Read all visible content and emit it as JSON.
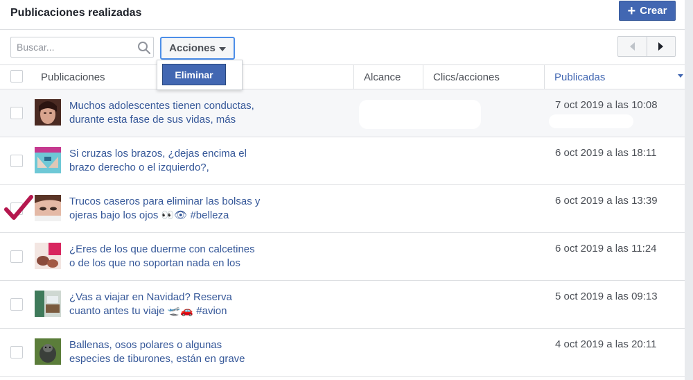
{
  "header": {
    "title": "Publicaciones realizadas",
    "create_label": "Crear"
  },
  "toolbar": {
    "search_placeholder": "Buscar...",
    "actions_label": "Acciones",
    "dropdown_item": "Eliminar"
  },
  "table": {
    "columns": [
      "Publicaciones",
      "Alcance",
      "Clics/acciones",
      "Publicadas"
    ],
    "rows": [
      {
        "line1": "Muchos adolescentes tienen conductas,",
        "line2": "durante esta fase de sus vidas, más",
        "date": "7 oct 2019 a las 10:08"
      },
      {
        "line1": "Si cruzas los brazos, ¿dejas encima el",
        "line2": "brazo derecho o el izquierdo?,",
        "date": "6 oct 2019 a las 18:11"
      },
      {
        "line1": "Trucos caseros para eliminar las bolsas y",
        "line2": "ojeras bajo los ojos 👀👁 #belleza",
        "date": "6 oct 2019 a las 13:39"
      },
      {
        "line1": "¿Eres de los que duerme con calcetines",
        "line2": "o de los que no soportan nada en los",
        "date": "6 oct 2019 a las 11:24"
      },
      {
        "line1": "¿Vas a viajar en Navidad? Reserva",
        "line2": "cuanto antes tu viaje 🛫🚗 #avion",
        "date": "5 oct 2019 a las 09:13"
      },
      {
        "line1": "Ballenas, osos polares o algunas",
        "line2": "especies de tiburones, están en grave",
        "date": "4 oct 2019 a las 20:11"
      }
    ]
  },
  "colors": {
    "accent": "#4267b2",
    "link": "#365899",
    "check_mark": "#b5174e"
  },
  "icons": [
    "search-icon",
    "caret-down-icon",
    "plus-icon",
    "chevron-left-icon",
    "chevron-right-icon",
    "checkmark-icon"
  ]
}
